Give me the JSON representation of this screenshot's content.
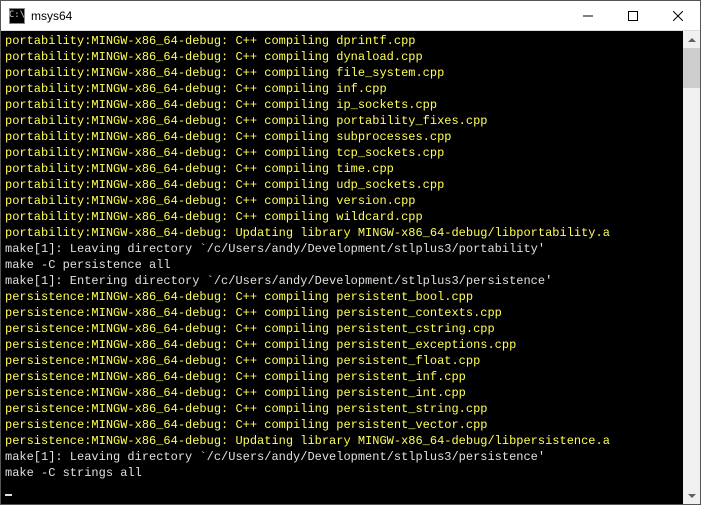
{
  "window": {
    "title": "msys64",
    "icon_glyph": "C:\\"
  },
  "terminal": {
    "lines": [
      {
        "color": "yellow",
        "text": "portability:MINGW-x86_64-debug: C++ compiling dprintf.cpp"
      },
      {
        "color": "yellow",
        "text": "portability:MINGW-x86_64-debug: C++ compiling dynaload.cpp"
      },
      {
        "color": "yellow",
        "text": "portability:MINGW-x86_64-debug: C++ compiling file_system.cpp"
      },
      {
        "color": "yellow",
        "text": "portability:MINGW-x86_64-debug: C++ compiling inf.cpp"
      },
      {
        "color": "yellow",
        "text": "portability:MINGW-x86_64-debug: C++ compiling ip_sockets.cpp"
      },
      {
        "color": "yellow",
        "text": "portability:MINGW-x86_64-debug: C++ compiling portability_fixes.cpp"
      },
      {
        "color": "yellow",
        "text": "portability:MINGW-x86_64-debug: C++ compiling subprocesses.cpp"
      },
      {
        "color": "yellow",
        "text": "portability:MINGW-x86_64-debug: C++ compiling tcp_sockets.cpp"
      },
      {
        "color": "yellow",
        "text": "portability:MINGW-x86_64-debug: C++ compiling time.cpp"
      },
      {
        "color": "yellow",
        "text": "portability:MINGW-x86_64-debug: C++ compiling udp_sockets.cpp"
      },
      {
        "color": "yellow",
        "text": "portability:MINGW-x86_64-debug: C++ compiling version.cpp"
      },
      {
        "color": "yellow",
        "text": "portability:MINGW-x86_64-debug: C++ compiling wildcard.cpp"
      },
      {
        "color": "yellow",
        "text": "portability:MINGW-x86_64-debug: Updating library MINGW-x86_64-debug/libportability.a"
      },
      {
        "color": "white",
        "text": "make[1]: Leaving directory `/c/Users/andy/Development/stlplus3/portability'"
      },
      {
        "color": "white",
        "text": "make -C persistence all"
      },
      {
        "color": "white",
        "text": "make[1]: Entering directory `/c/Users/andy/Development/stlplus3/persistence'"
      },
      {
        "color": "yellow",
        "text": "persistence:MINGW-x86_64-debug: C++ compiling persistent_bool.cpp"
      },
      {
        "color": "yellow",
        "text": "persistence:MINGW-x86_64-debug: C++ compiling persistent_contexts.cpp"
      },
      {
        "color": "yellow",
        "text": "persistence:MINGW-x86_64-debug: C++ compiling persistent_cstring.cpp"
      },
      {
        "color": "yellow",
        "text": "persistence:MINGW-x86_64-debug: C++ compiling persistent_exceptions.cpp"
      },
      {
        "color": "yellow",
        "text": "persistence:MINGW-x86_64-debug: C++ compiling persistent_float.cpp"
      },
      {
        "color": "yellow",
        "text": "persistence:MINGW-x86_64-debug: C++ compiling persistent_inf.cpp"
      },
      {
        "color": "yellow",
        "text": "persistence:MINGW-x86_64-debug: C++ compiling persistent_int.cpp"
      },
      {
        "color": "yellow",
        "text": "persistence:MINGW-x86_64-debug: C++ compiling persistent_string.cpp"
      },
      {
        "color": "yellow",
        "text": "persistence:MINGW-x86_64-debug: C++ compiling persistent_vector.cpp"
      },
      {
        "color": "yellow",
        "text": "persistence:MINGW-x86_64-debug: Updating library MINGW-x86_64-debug/libpersistence.a"
      },
      {
        "color": "white",
        "text": "make[1]: Leaving directory `/c/Users/andy/Development/stlplus3/persistence'"
      },
      {
        "color": "white",
        "text": "make -C strings all"
      }
    ]
  }
}
